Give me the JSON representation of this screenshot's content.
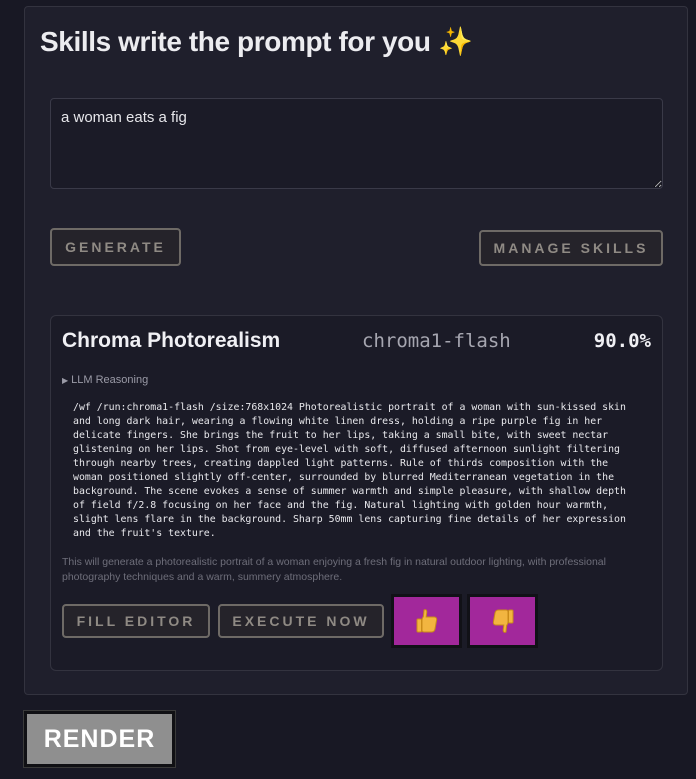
{
  "header": {
    "title": "Skills write the prompt for you",
    "title_emoji": "✨"
  },
  "prompt": {
    "value": "a woman eats a fig",
    "placeholder": ""
  },
  "actions": {
    "generate_label": "Generate",
    "manage_label": "Manage Skills"
  },
  "result": {
    "skill_name": "Chroma Photorealism",
    "model": "chroma1-flash",
    "score": "90.0%",
    "reasoning_label": "LLM Reasoning",
    "command": "/wf /run:chroma1-flash /size:768x1024 Photorealistic portrait of a woman with sun-kissed skin and long dark hair, wearing a flowing white linen dress, holding a ripe purple fig in her delicate fingers. She brings the fruit to her lips, taking a small bite, with sweet nectar glistening on her lips. Shot from eye-level with soft, diffused afternoon sunlight filtering through nearby trees, creating dappled light patterns. Rule of thirds composition with the woman positioned slightly off-center, surrounded by blurred Mediterranean vegetation in the background. The scene evokes a sense of summer warmth and simple pleasure, with shallow depth of field f/2.8 focusing on her face and the fig. Natural lighting with golden hour warmth, slight lens flare in the background. Sharp 50mm lens capturing fine details of her expression and the fruit's texture.",
    "summary": "This will generate a photorealistic portrait of a woman enjoying a fresh fig in natural outdoor lighting, with professional photography techniques and a warm, summery atmosphere.",
    "fill_label": "Fill Editor",
    "execute_label": "Execute Now",
    "thumbs_up_icon": "thumbs-up",
    "thumbs_down_icon": "thumbs-down"
  },
  "footer": {
    "render_label": "RENDER"
  },
  "colors": {
    "background": "#181824",
    "panel": "#1f1f2c",
    "feedback_button": "#a2289b",
    "render_button": "#8f8f8f"
  }
}
